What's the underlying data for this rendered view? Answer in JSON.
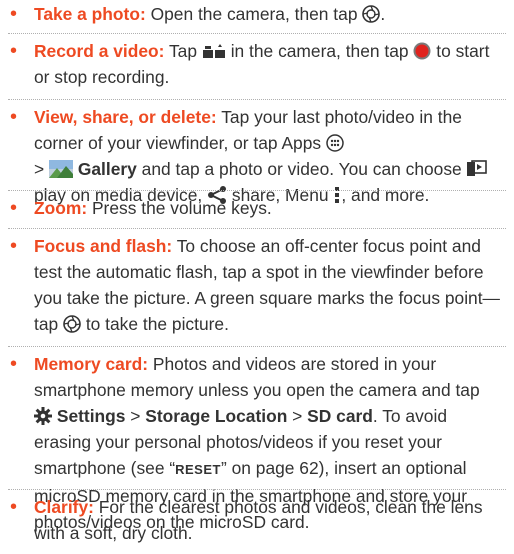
{
  "accent_color": "#ee4a22",
  "items": [
    {
      "heading": "Take a photo:",
      "t1": " Open the camera, then tap ",
      "t2": "."
    },
    {
      "heading": "Record a video:",
      "t1": " Tap ",
      "t2": " in the camera, then tap ",
      "t3": " to start or stop recording."
    },
    {
      "heading": "View, share, or delete:",
      "t1": " Tap your last photo/video in the corner of your viewfinder, or tap Apps ",
      "t2": "> ",
      "gallery": "Gallery",
      "t3": " and tap a photo or video. You can choose ",
      "t4": " play on media device, ",
      "t5": " share, Menu ",
      "t6": ", and more."
    },
    {
      "heading": "Zoom:",
      "t1": " Press the volume keys."
    },
    {
      "heading": "Focus and flash:",
      "t1": " To choose an off-center focus point and test the automatic flash, tap a spot in the viewfinder before you take the picture. A green square marks the focus point—tap ",
      "t2": " to take the picture."
    },
    {
      "heading": "Memory card:",
      "t1": " Photos and videos are stored in your smartphone memory unless you open the camera and tap ",
      "settings": "Settings",
      "gt1": " > ",
      "storage": "Storage Location",
      "gt2": " > ",
      "sd": "SD card",
      "t2": ". To avoid erasing your personal photos/videos if you reset your smartphone (see “",
      "reset": "RESET",
      "t3": "” on page 62), insert an optional microSD memory card in the smartphone and store your photos/videos on the microSD card."
    },
    {
      "heading": "Clarify:",
      "t1": " For the clearest photos and videos, clean the lens with a soft, dry cloth."
    }
  ]
}
